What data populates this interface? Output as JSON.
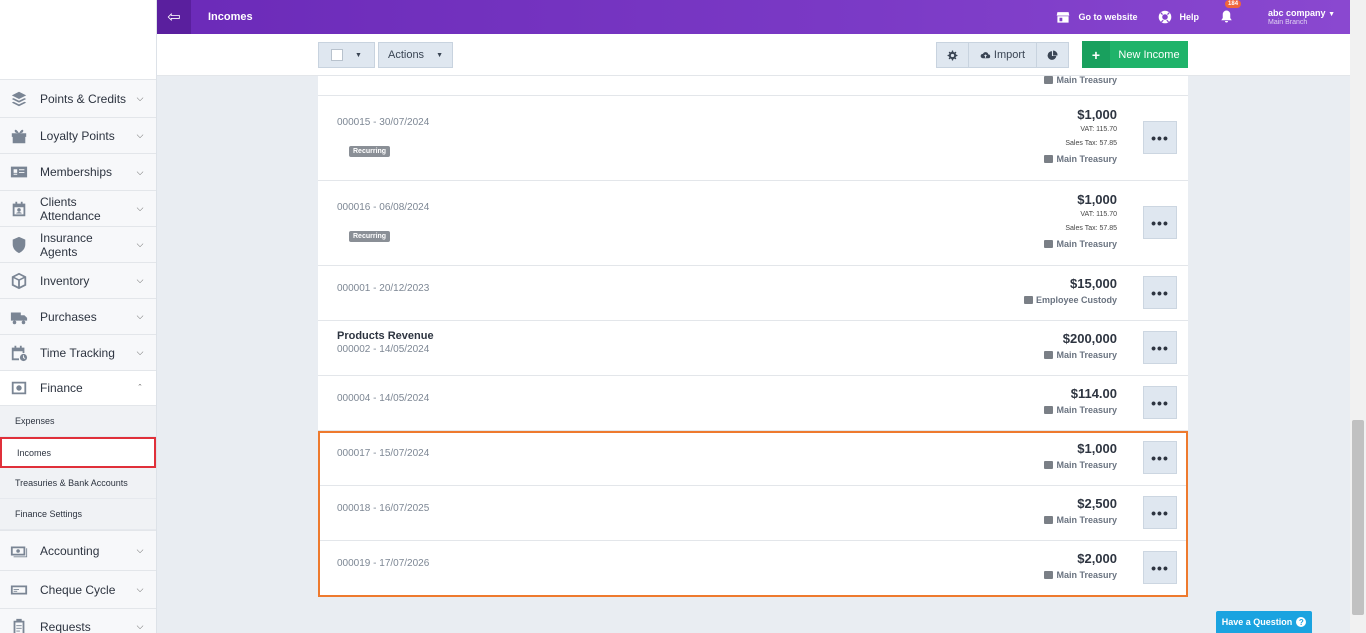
{
  "topbar": {
    "title": "Incomes",
    "go_to_website": "Go to website",
    "help": "Help",
    "notifications_count": "184",
    "company": "abc company",
    "branch": "Main Branch"
  },
  "sidebar": {
    "items": [
      {
        "label": "Points & Credits",
        "icon": "layers-icon"
      },
      {
        "label": "Loyalty Points",
        "icon": "gift-icon"
      },
      {
        "label": "Memberships",
        "icon": "id-card-icon"
      },
      {
        "label": "Clients Attendance",
        "icon": "calendar-user-icon"
      },
      {
        "label": "Insurance Agents",
        "icon": "shield-icon"
      },
      {
        "label": "Inventory",
        "icon": "box-icon"
      },
      {
        "label": "Purchases",
        "icon": "truck-icon"
      },
      {
        "label": "Time Tracking",
        "icon": "calendar-clock-icon"
      },
      {
        "label": "Finance",
        "icon": "safe-icon"
      },
      {
        "label": "Accounting",
        "icon": "money-icon"
      },
      {
        "label": "Cheque Cycle",
        "icon": "cheque-icon"
      },
      {
        "label": "Requests",
        "icon": "clipboard-icon"
      }
    ],
    "finance_sub": [
      {
        "label": "Expenses"
      },
      {
        "label": "Incomes"
      },
      {
        "label": "Treasuries & Bank Accounts"
      },
      {
        "label": "Finance Settings"
      }
    ]
  },
  "toolbar": {
    "actions_label": "Actions",
    "import_label": "Import",
    "new_income_label": "New Income"
  },
  "list": {
    "partial_treasury": "Main Treasury",
    "rows": [
      {
        "meta": "000015 - 30/07/2024",
        "tag": "Recurring",
        "amount": "$1,000",
        "vat": "VAT: 115.70",
        "sales_tax": "Sales Tax: 57.85",
        "treasury": "Main Treasury"
      },
      {
        "meta": "000016 - 06/08/2024",
        "tag": "Recurring",
        "amount": "$1,000",
        "vat": "VAT: 115.70",
        "sales_tax": "Sales Tax: 57.85",
        "treasury": "Main Treasury"
      },
      {
        "meta": "000001 - 20/12/2023",
        "amount": "$15,000",
        "treasury": "Employee Custody"
      },
      {
        "title": "Products Revenue",
        "meta": "000002 - 14/05/2024",
        "amount": "$200,000",
        "treasury": "Main Treasury"
      },
      {
        "meta": "000004 - 14/05/2024",
        "amount": "$114.00",
        "treasury": "Main Treasury"
      },
      {
        "meta": "000017 - 15/07/2024",
        "amount": "$1,000",
        "treasury": "Main Treasury"
      },
      {
        "meta": "000018 - 16/07/2025",
        "amount": "$2,500",
        "treasury": "Main Treasury"
      },
      {
        "meta": "000019 - 17/07/2026",
        "amount": "$2,000",
        "treasury": "Main Treasury"
      }
    ]
  },
  "help_button": "Have a Question"
}
